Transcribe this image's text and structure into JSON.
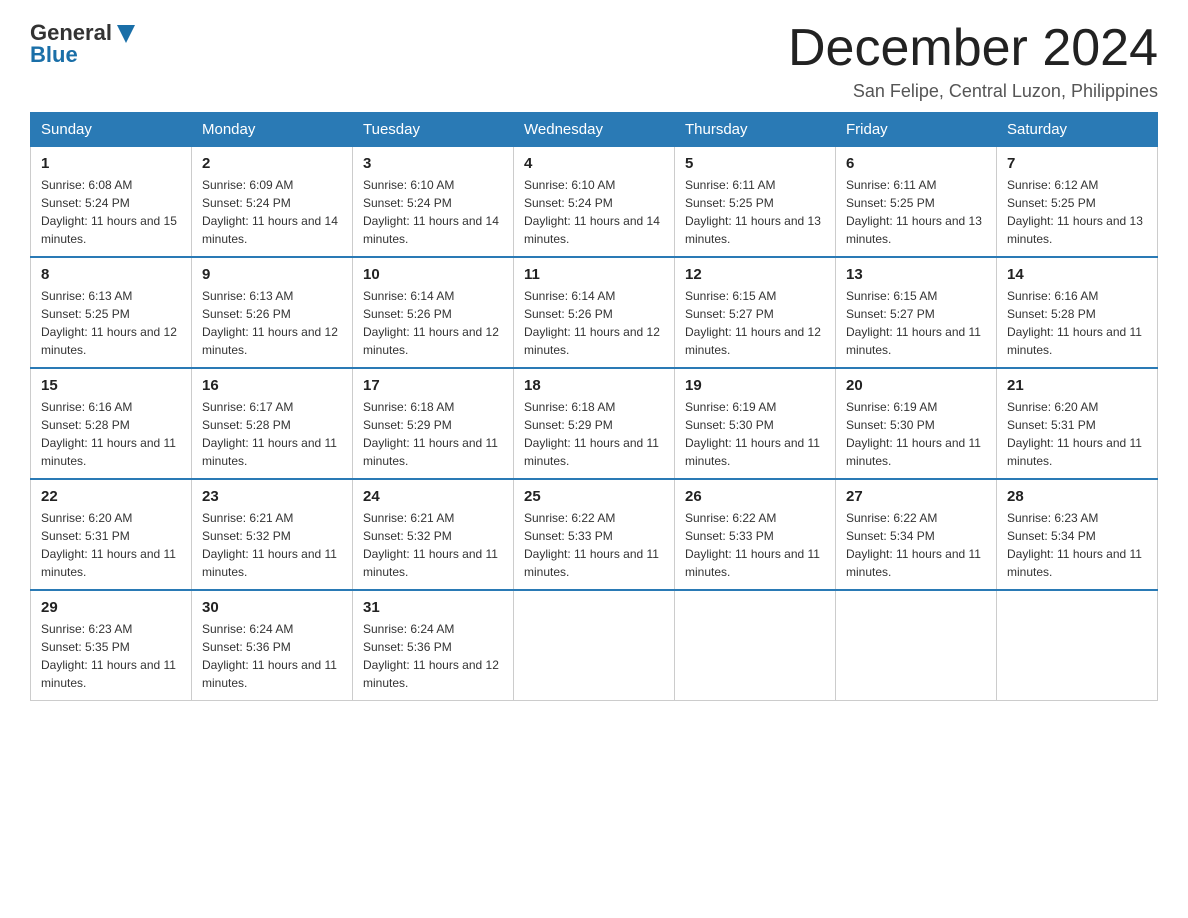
{
  "header": {
    "logo": {
      "general": "General",
      "blue": "Blue"
    },
    "title": "December 2024",
    "location": "San Felipe, Central Luzon, Philippines"
  },
  "calendar": {
    "days_of_week": [
      "Sunday",
      "Monday",
      "Tuesday",
      "Wednesday",
      "Thursday",
      "Friday",
      "Saturday"
    ],
    "weeks": [
      [
        {
          "day": "1",
          "sunrise": "6:08 AM",
          "sunset": "5:24 PM",
          "daylight": "11 hours and 15 minutes."
        },
        {
          "day": "2",
          "sunrise": "6:09 AM",
          "sunset": "5:24 PM",
          "daylight": "11 hours and 14 minutes."
        },
        {
          "day": "3",
          "sunrise": "6:10 AM",
          "sunset": "5:24 PM",
          "daylight": "11 hours and 14 minutes."
        },
        {
          "day": "4",
          "sunrise": "6:10 AM",
          "sunset": "5:24 PM",
          "daylight": "11 hours and 14 minutes."
        },
        {
          "day": "5",
          "sunrise": "6:11 AM",
          "sunset": "5:25 PM",
          "daylight": "11 hours and 13 minutes."
        },
        {
          "day": "6",
          "sunrise": "6:11 AM",
          "sunset": "5:25 PM",
          "daylight": "11 hours and 13 minutes."
        },
        {
          "day": "7",
          "sunrise": "6:12 AM",
          "sunset": "5:25 PM",
          "daylight": "11 hours and 13 minutes."
        }
      ],
      [
        {
          "day": "8",
          "sunrise": "6:13 AM",
          "sunset": "5:25 PM",
          "daylight": "11 hours and 12 minutes."
        },
        {
          "day": "9",
          "sunrise": "6:13 AM",
          "sunset": "5:26 PM",
          "daylight": "11 hours and 12 minutes."
        },
        {
          "day": "10",
          "sunrise": "6:14 AM",
          "sunset": "5:26 PM",
          "daylight": "11 hours and 12 minutes."
        },
        {
          "day": "11",
          "sunrise": "6:14 AM",
          "sunset": "5:26 PM",
          "daylight": "11 hours and 12 minutes."
        },
        {
          "day": "12",
          "sunrise": "6:15 AM",
          "sunset": "5:27 PM",
          "daylight": "11 hours and 12 minutes."
        },
        {
          "day": "13",
          "sunrise": "6:15 AM",
          "sunset": "5:27 PM",
          "daylight": "11 hours and 11 minutes."
        },
        {
          "day": "14",
          "sunrise": "6:16 AM",
          "sunset": "5:28 PM",
          "daylight": "11 hours and 11 minutes."
        }
      ],
      [
        {
          "day": "15",
          "sunrise": "6:16 AM",
          "sunset": "5:28 PM",
          "daylight": "11 hours and 11 minutes."
        },
        {
          "day": "16",
          "sunrise": "6:17 AM",
          "sunset": "5:28 PM",
          "daylight": "11 hours and 11 minutes."
        },
        {
          "day": "17",
          "sunrise": "6:18 AM",
          "sunset": "5:29 PM",
          "daylight": "11 hours and 11 minutes."
        },
        {
          "day": "18",
          "sunrise": "6:18 AM",
          "sunset": "5:29 PM",
          "daylight": "11 hours and 11 minutes."
        },
        {
          "day": "19",
          "sunrise": "6:19 AM",
          "sunset": "5:30 PM",
          "daylight": "11 hours and 11 minutes."
        },
        {
          "day": "20",
          "sunrise": "6:19 AM",
          "sunset": "5:30 PM",
          "daylight": "11 hours and 11 minutes."
        },
        {
          "day": "21",
          "sunrise": "6:20 AM",
          "sunset": "5:31 PM",
          "daylight": "11 hours and 11 minutes."
        }
      ],
      [
        {
          "day": "22",
          "sunrise": "6:20 AM",
          "sunset": "5:31 PM",
          "daylight": "11 hours and 11 minutes."
        },
        {
          "day": "23",
          "sunrise": "6:21 AM",
          "sunset": "5:32 PM",
          "daylight": "11 hours and 11 minutes."
        },
        {
          "day": "24",
          "sunrise": "6:21 AM",
          "sunset": "5:32 PM",
          "daylight": "11 hours and 11 minutes."
        },
        {
          "day": "25",
          "sunrise": "6:22 AM",
          "sunset": "5:33 PM",
          "daylight": "11 hours and 11 minutes."
        },
        {
          "day": "26",
          "sunrise": "6:22 AM",
          "sunset": "5:33 PM",
          "daylight": "11 hours and 11 minutes."
        },
        {
          "day": "27",
          "sunrise": "6:22 AM",
          "sunset": "5:34 PM",
          "daylight": "11 hours and 11 minutes."
        },
        {
          "day": "28",
          "sunrise": "6:23 AM",
          "sunset": "5:34 PM",
          "daylight": "11 hours and 11 minutes."
        }
      ],
      [
        {
          "day": "29",
          "sunrise": "6:23 AM",
          "sunset": "5:35 PM",
          "daylight": "11 hours and 11 minutes."
        },
        {
          "day": "30",
          "sunrise": "6:24 AM",
          "sunset": "5:36 PM",
          "daylight": "11 hours and 11 minutes."
        },
        {
          "day": "31",
          "sunrise": "6:24 AM",
          "sunset": "5:36 PM",
          "daylight": "11 hours and 12 minutes."
        },
        null,
        null,
        null,
        null
      ]
    ]
  }
}
